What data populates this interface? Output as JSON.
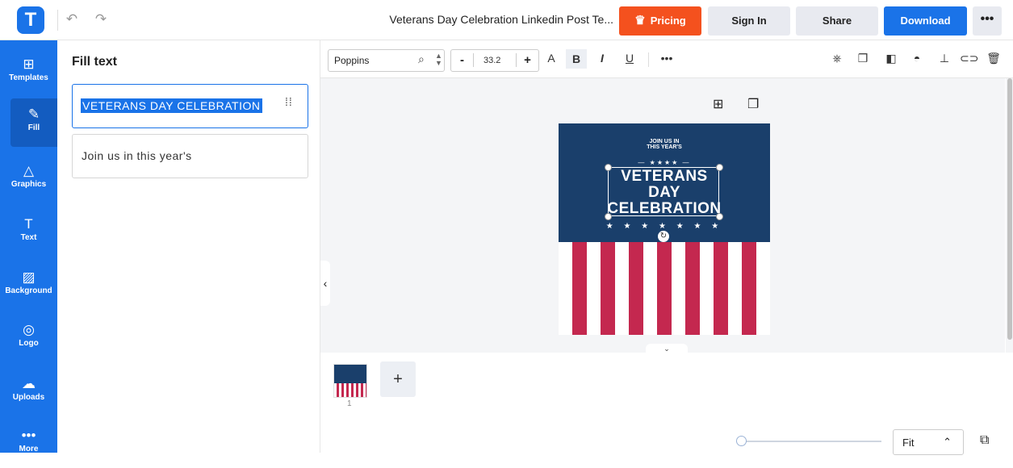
{
  "header": {
    "logo_letter": "T",
    "doc_title": "Veterans Day Celebration Linkedin Post Te...",
    "pricing_label": "Pricing",
    "signin_label": "Sign In",
    "share_label": "Share",
    "download_label": "Download",
    "more_label": "•••"
  },
  "sidebar": {
    "items": [
      {
        "label": "Templates",
        "icon": "⊞"
      },
      {
        "label": "Fill",
        "icon": "✎"
      },
      {
        "label": "Graphics",
        "icon": "△"
      },
      {
        "label": "Text",
        "icon": "T"
      },
      {
        "label": "Background",
        "icon": "▨"
      },
      {
        "label": "Logo",
        "icon": "◎"
      },
      {
        "label": "Uploads",
        "icon": "☁"
      },
      {
        "label": "More",
        "icon": "•••"
      }
    ]
  },
  "panel": {
    "title": "Fill text",
    "fields": [
      {
        "value": "VETERANS DAY CELEBRATION"
      },
      {
        "value": "Join us in this year's"
      }
    ]
  },
  "toolbar": {
    "font_name": "Poppins",
    "font_size": "33.2",
    "minus": "-",
    "plus": "+"
  },
  "artwork": {
    "small_line1": "JOIN US IN",
    "small_line2": "THIS YEAR'S",
    "divider": "— ★★★★ —",
    "line1": "VETERANS",
    "line2": "DAY",
    "line3": "CELEBRATION",
    "stars": "★ ★ ★ ★ ★ ★ ★"
  },
  "pages": {
    "current_page": "1",
    "add_label": "+"
  },
  "zoom": {
    "label": "Fit"
  },
  "colors": {
    "brand": "#1a73e8",
    "pricing": "#f4511e",
    "navy": "#1a3f6b",
    "stripe_red": "#c4284f"
  }
}
